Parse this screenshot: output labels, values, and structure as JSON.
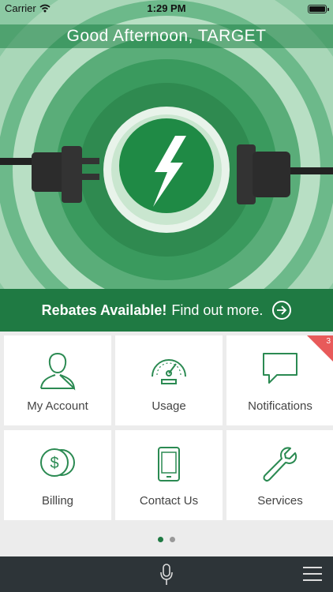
{
  "status_bar": {
    "carrier": "Carrier",
    "time": "1:29 PM"
  },
  "hero": {
    "greeting": "Good Afternoon, TARGET"
  },
  "rebate": {
    "bold_text": "Rebates Available!",
    "text": "Find out more."
  },
  "tiles": [
    {
      "label": "My Account",
      "icon": "user-icon"
    },
    {
      "label": "Usage",
      "icon": "gauge-icon"
    },
    {
      "label": "Notifications",
      "icon": "chat-bubble-icon",
      "badge": "3"
    },
    {
      "label": "Billing",
      "icon": "coins-icon"
    },
    {
      "label": "Contact Us",
      "icon": "phone-icon"
    },
    {
      "label": "Services",
      "icon": "wrench-icon"
    }
  ],
  "pager": {
    "pages": 2,
    "current": 1
  },
  "colors": {
    "brand": "#1f7a43",
    "icon": "#2b8a52",
    "badge": "#e85a5a",
    "bottom_bar": "#2d3438"
  }
}
